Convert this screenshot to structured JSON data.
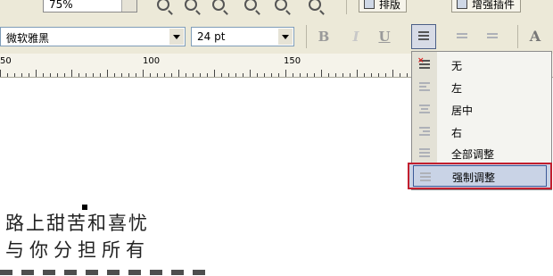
{
  "toolbar_top": {
    "zoom_value": "75%",
    "layout_button": "排版",
    "plugin_button": "增强插件"
  },
  "toolbar_font": {
    "font_name": "微软雅黑",
    "font_size": "24 pt",
    "bold": "B",
    "italic": "I",
    "underline": "U",
    "text_style": "A"
  },
  "ruler": {
    "labels": [
      "50",
      "100",
      "150"
    ]
  },
  "align_menu": {
    "items": [
      {
        "label": "无",
        "icon": "align-none-icon"
      },
      {
        "label": "左",
        "icon": "align-left-icon"
      },
      {
        "label": "居中",
        "icon": "align-center-icon"
      },
      {
        "label": "右",
        "icon": "align-right-icon"
      },
      {
        "label": "全部调整",
        "icon": "justify-all-icon"
      },
      {
        "label": "强制调整",
        "icon": "force-justify-icon"
      }
    ],
    "selected_index": 5,
    "highlight_color": "#c21f2e"
  },
  "canvas_text": {
    "lines": [
      "路上甜苦和喜忧",
      "与你分担所有"
    ]
  }
}
